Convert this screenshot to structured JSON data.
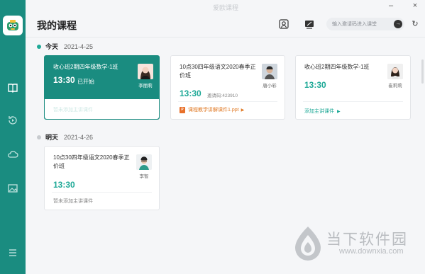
{
  "window": {
    "title": "爱欧课程",
    "minimize": "–",
    "close": "×"
  },
  "header": {
    "title": "我的课程",
    "search_placeholder": "输入邀请码进入课堂",
    "search_go": "→",
    "refresh": "↻"
  },
  "colors": {
    "brand": "#1a8c80",
    "accent": "#1fa997",
    "file": "#e07a26"
  },
  "icons": {
    "sidebar": [
      "book-icon",
      "replay-icon",
      "cloud-icon",
      "image-icon",
      "menu-icon"
    ],
    "header": [
      "user-badge-icon",
      "whiteboard-icon"
    ]
  },
  "days": [
    {
      "label": "今天",
      "date": "2021-4-25",
      "cards": [
        {
          "title": "收心班2期四年级数学-1班",
          "time": "13:30",
          "status": "已开始",
          "teacher": "李丽莉",
          "footer": "暂未添加主讲课件"
        },
        {
          "title": "10点30四年级语文2020春季正价班",
          "time": "13:30",
          "code": "邀请码:423910",
          "teacher": "唐小彩",
          "file": "课程教学讲解课件1.ppt"
        },
        {
          "title": "收心班2期四年级数学-1班",
          "time": "13:30",
          "teacher": "崔莉莉",
          "link": "添加主讲课件"
        }
      ]
    },
    {
      "label": "明天",
      "date": "2021-4-26",
      "cards": [
        {
          "title": "10点30四年级语文2020春季正价班",
          "time": "13:30",
          "teacher": "李智",
          "footer": "暂未添加主讲课件"
        }
      ]
    }
  ],
  "watermark": {
    "text": "当下软件园",
    "url": "www.downxia.com"
  }
}
